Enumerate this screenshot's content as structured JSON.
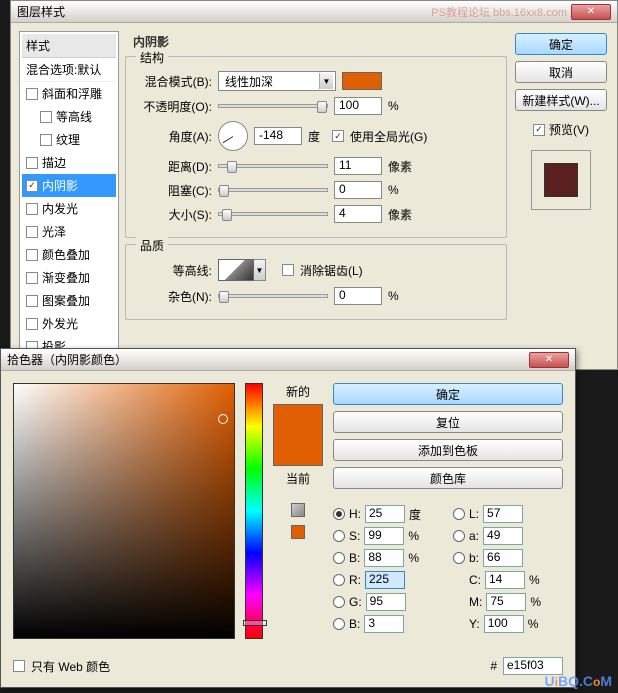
{
  "layerDialog": {
    "title": "图层样式",
    "watermark": "PS教程论坛 bbs.16xx8.com",
    "stylesHeader": "样式",
    "blendOptions": "混合选项:默认",
    "items": [
      {
        "label": "斜面和浮雕",
        "checked": false,
        "indent": false
      },
      {
        "label": "等高线",
        "checked": false,
        "indent": true
      },
      {
        "label": "纹理",
        "checked": false,
        "indent": true
      },
      {
        "label": "描边",
        "checked": false,
        "indent": false
      },
      {
        "label": "内阴影",
        "checked": true,
        "indent": false,
        "selected": true
      },
      {
        "label": "内发光",
        "checked": false,
        "indent": false
      },
      {
        "label": "光泽",
        "checked": false,
        "indent": false
      },
      {
        "label": "颜色叠加",
        "checked": false,
        "indent": false
      },
      {
        "label": "渐变叠加",
        "checked": false,
        "indent": false
      },
      {
        "label": "图案叠加",
        "checked": false,
        "indent": false
      },
      {
        "label": "外发光",
        "checked": false,
        "indent": false
      },
      {
        "label": "投影",
        "checked": false,
        "indent": false
      }
    ],
    "panelTitle": "内阴影",
    "structureLabel": "结构",
    "blendModeLabel": "混合模式(B):",
    "blendModeValue": "线性加深",
    "opacityLabel": "不透明度(O):",
    "opacityValue": "100",
    "percent": "%",
    "angleLabel": "角度(A):",
    "angleValue": "-148",
    "degree": "度",
    "globalLight": "使用全局光(G)",
    "globalLightChecked": true,
    "distanceLabel": "距离(D):",
    "distanceValue": "11",
    "pixels": "像素",
    "chokeLabel": "阻塞(C):",
    "chokeValue": "0",
    "sizeLabel": "大小(S):",
    "sizeValue": "4",
    "qualityLabel": "品质",
    "contourLabel": "等高线:",
    "antiAlias": "消除锯齿(L)",
    "noiseLabel": "杂色(N):",
    "noiseValue": "0",
    "buttons": {
      "ok": "确定",
      "cancel": "取消",
      "newStyle": "新建样式(W)...",
      "preview": "预览(V)"
    }
  },
  "picker": {
    "title": "拾色器（内阴影颜色）",
    "newLabel": "新的",
    "currentLabel": "当前",
    "buttons": {
      "ok": "确定",
      "reset": "复位",
      "addSwatch": "添加到色板",
      "colorLib": "颜色库"
    },
    "H": {
      "label": "H:",
      "value": "25",
      "unit": "度"
    },
    "S": {
      "label": "S:",
      "value": "99",
      "unit": "%"
    },
    "Bv": {
      "label": "B:",
      "value": "88",
      "unit": "%"
    },
    "R": {
      "label": "R:",
      "value": "225"
    },
    "G": {
      "label": "G:",
      "value": "95"
    },
    "Bc": {
      "label": "B:",
      "value": "3"
    },
    "L": {
      "label": "L:",
      "value": "57"
    },
    "a": {
      "label": "a:",
      "value": "49"
    },
    "b": {
      "label": "b:",
      "value": "66"
    },
    "C": {
      "label": "C:",
      "value": "14",
      "unit": "%"
    },
    "M": {
      "label": "M:",
      "value": "75",
      "unit": "%"
    },
    "Y": {
      "label": "Y:",
      "value": "100",
      "unit": "%"
    },
    "webOnly": "只有 Web 颜色",
    "hexPrefix": "#",
    "hex": "e15f03",
    "newColor": "#e15f03",
    "currentColor": "#e15f03"
  },
  "watermark2": "UiBQ.CoM"
}
